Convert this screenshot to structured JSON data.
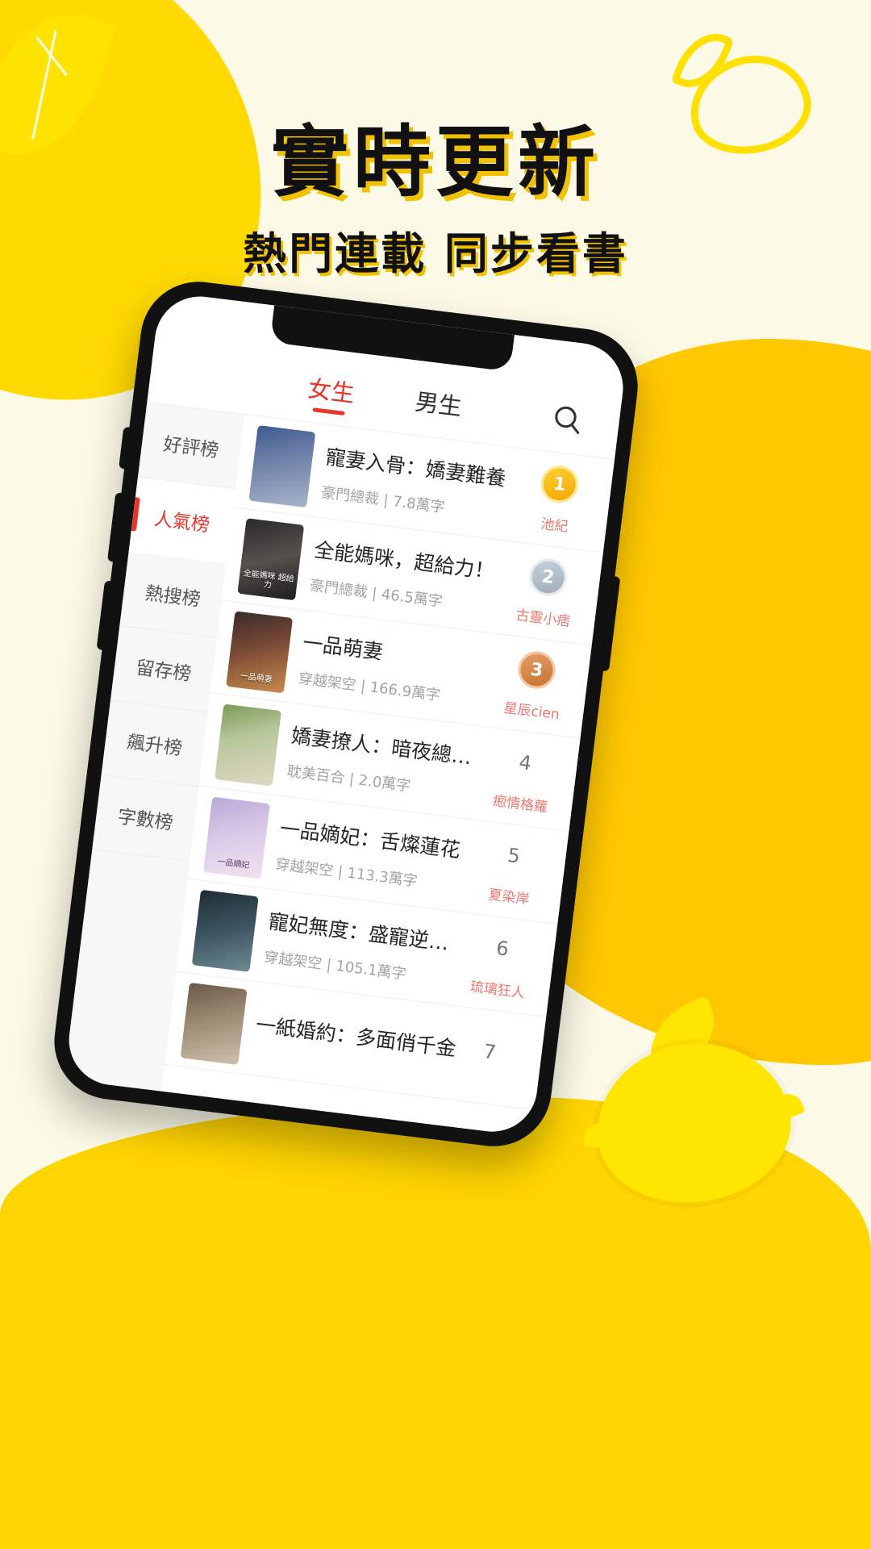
{
  "hero": {
    "headline": "實時更新",
    "subheadline": "熱門連載 同步看書",
    "accent_color": "#FFD900",
    "text_color": "#111111",
    "shadow_color": "#F2C200",
    "background_color": "#FCFAE6"
  },
  "app": {
    "tabs": [
      {
        "label": "女生",
        "active": true
      },
      {
        "label": "男生",
        "active": false
      }
    ],
    "search_icon": "search-icon",
    "sidebar": [
      {
        "label": "好評榜",
        "active": false
      },
      {
        "label": "人氣榜",
        "active": true
      },
      {
        "label": "熱搜榜",
        "active": false
      },
      {
        "label": "留存榜",
        "active": false
      },
      {
        "label": "飆升榜",
        "active": false
      },
      {
        "label": "字數榜",
        "active": false
      }
    ],
    "active_color": "#E8342B",
    "books": [
      {
        "rank": "1",
        "medal": "gold",
        "title": "寵妻入骨：嬌妻難養",
        "category": "豪門總裁",
        "words": "7.8萬字",
        "meta": "豪門總裁 | 7.8萬字",
        "author": "池紀",
        "cover_text": ""
      },
      {
        "rank": "2",
        "medal": "silver",
        "title": "全能媽咪，超給力！",
        "category": "豪門總裁",
        "words": "46.5萬字",
        "meta": "豪門總裁 | 46.5萬字",
        "author": "古靈小痞",
        "cover_text": "全能媽咪\n超給力"
      },
      {
        "rank": "3",
        "medal": "bronze",
        "title": "一品萌妻",
        "category": "穿越架空",
        "words": "166.9萬字",
        "meta": "穿越架空 | 166.9萬字",
        "author": "星辰cien",
        "cover_text": "一品萌妻"
      },
      {
        "rank": "4",
        "medal": "none",
        "title": "嬌妻撩人：暗夜總裁强…",
        "category": "耽美百合",
        "words": "2.0萬字",
        "meta": "耽美百合 | 2.0萬字",
        "author": "瘛情格蘿",
        "cover_text": ""
      },
      {
        "rank": "5",
        "medal": "none",
        "title": "一品嫡妃：舌燦蓮花",
        "category": "穿越架空",
        "words": "113.3萬字",
        "meta": "穿越架空 | 113.3萬字",
        "author": "夏染岸",
        "cover_text": "一品嫡妃"
      },
      {
        "rank": "6",
        "medal": "none",
        "title": "寵妃無度：盛寵逆天小…",
        "category": "穿越架空",
        "words": "105.1萬字",
        "meta": "穿越架空 | 105.1萬字",
        "author": "琉璃狂人",
        "cover_text": ""
      },
      {
        "rank": "7",
        "medal": "none",
        "title": "一紙婚約：多面俏千金",
        "category": "",
        "words": "",
        "meta": "",
        "author": "",
        "cover_text": ""
      }
    ]
  }
}
